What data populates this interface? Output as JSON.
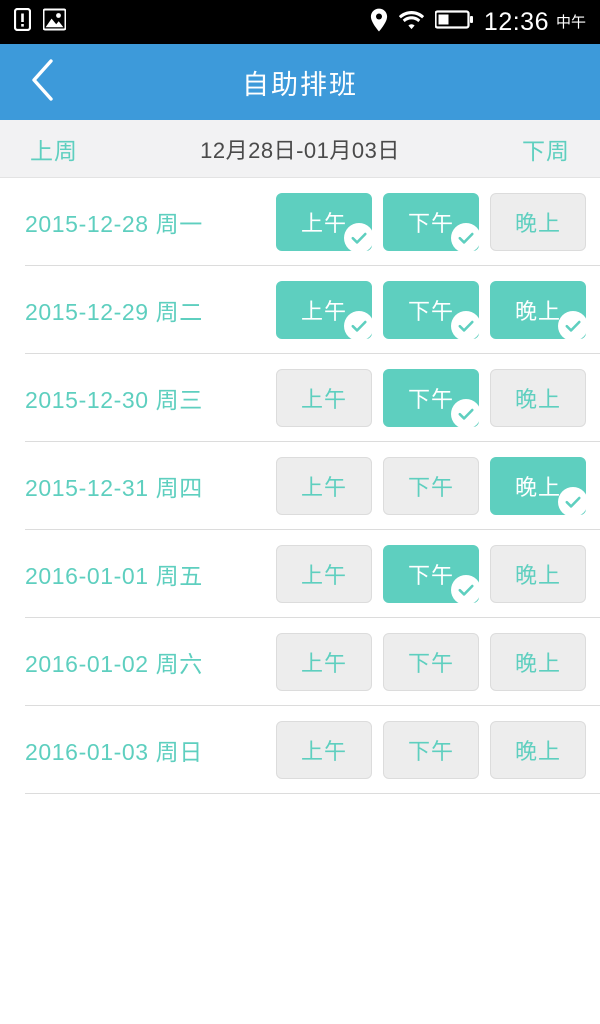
{
  "statusbar": {
    "left_icons": [
      "sim-alert-icon",
      "image-icon"
    ],
    "right_icons": [
      "location-pin-icon",
      "wifi-icon",
      "battery-icon"
    ],
    "time": "12:36",
    "ampm": "中午",
    "background": "#000000",
    "foreground": "#ffffff"
  },
  "header": {
    "back_icon": "chevron-left-icon",
    "title": "自助排班",
    "background": "#3d9ada",
    "text_color": "#ffffff"
  },
  "weeknav": {
    "prev_label": "上周",
    "range_label": "12月28日-01月03日",
    "next_label": "下周",
    "link_color": "#5ecfbf",
    "range_color": "#4a4a4a",
    "background": "#f2f2f3"
  },
  "colors": {
    "accent_teal": "#5ecfbf",
    "header_blue": "#3d9ada",
    "slot_off_bg": "#ededed",
    "slot_off_border": "#dcdcdc",
    "divider": "#dcdcdc",
    "page_bg": "#ffffff"
  },
  "slot_labels": {
    "morning": "上午",
    "afternoon": "下午",
    "evening": "晚上"
  },
  "schedule": {
    "rows": [
      {
        "date": "2015-12-28 周一",
        "slots": [
          {
            "label": "上午",
            "selected": true
          },
          {
            "label": "下午",
            "selected": true
          },
          {
            "label": "晚上",
            "selected": false
          }
        ]
      },
      {
        "date": "2015-12-29 周二",
        "slots": [
          {
            "label": "上午",
            "selected": true
          },
          {
            "label": "下午",
            "selected": true
          },
          {
            "label": "晚上",
            "selected": true
          }
        ]
      },
      {
        "date": "2015-12-30 周三",
        "slots": [
          {
            "label": "上午",
            "selected": false
          },
          {
            "label": "下午",
            "selected": true
          },
          {
            "label": "晚上",
            "selected": false
          }
        ]
      },
      {
        "date": "2015-12-31 周四",
        "slots": [
          {
            "label": "上午",
            "selected": false
          },
          {
            "label": "下午",
            "selected": false
          },
          {
            "label": "晚上",
            "selected": true
          }
        ]
      },
      {
        "date": "2016-01-01 周五",
        "slots": [
          {
            "label": "上午",
            "selected": false
          },
          {
            "label": "下午",
            "selected": true
          },
          {
            "label": "晚上",
            "selected": false
          }
        ]
      },
      {
        "date": "2016-01-02 周六",
        "slots": [
          {
            "label": "上午",
            "selected": false
          },
          {
            "label": "下午",
            "selected": false
          },
          {
            "label": "晚上",
            "selected": false
          }
        ]
      },
      {
        "date": "2016-01-03 周日",
        "slots": [
          {
            "label": "上午",
            "selected": false
          },
          {
            "label": "下午",
            "selected": false
          },
          {
            "label": "晚上",
            "selected": false
          }
        ]
      }
    ]
  }
}
